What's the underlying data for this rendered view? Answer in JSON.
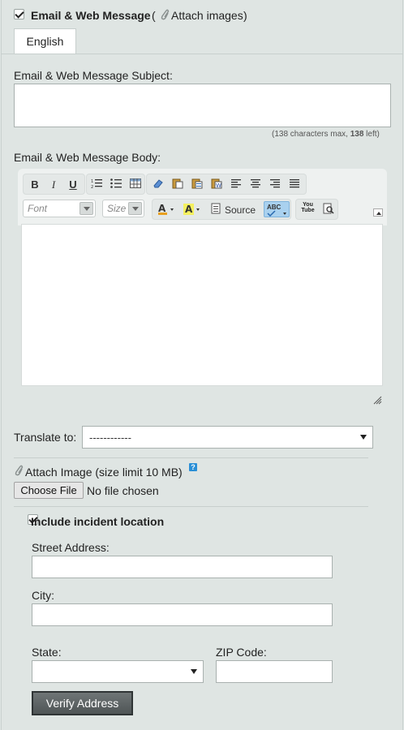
{
  "section": {
    "title": "Email & Web Message",
    "attach_open": " (",
    "attach_link": "Attach images",
    "attach_close": ")"
  },
  "tabs": [
    {
      "label": "English"
    }
  ],
  "subject": {
    "label": "Email & Web Message Subject:",
    "value": "",
    "char_prefix": "(138 characters max, ",
    "char_left": "138",
    "char_suffix": " left)"
  },
  "body": {
    "label": "Email & Web Message Body:"
  },
  "toolbar": {
    "font_placeholder": "Font",
    "size_placeholder": "Size",
    "source_label": "Source",
    "spell_label": "ABC",
    "youtube_label": "You Tube"
  },
  "translate": {
    "label": "Translate to:",
    "selected": "------------"
  },
  "attach": {
    "label": "Attach Image (size limit 10 MB)",
    "help": "?",
    "choose_label": "Choose File",
    "file_status": "No file chosen"
  },
  "location": {
    "label": "Include incident location",
    "street_label": "Street Address:",
    "city_label": "City:",
    "state_label": "State:",
    "state_selected": "",
    "zip_label": "ZIP Code:",
    "verify_label": "Verify Address"
  }
}
